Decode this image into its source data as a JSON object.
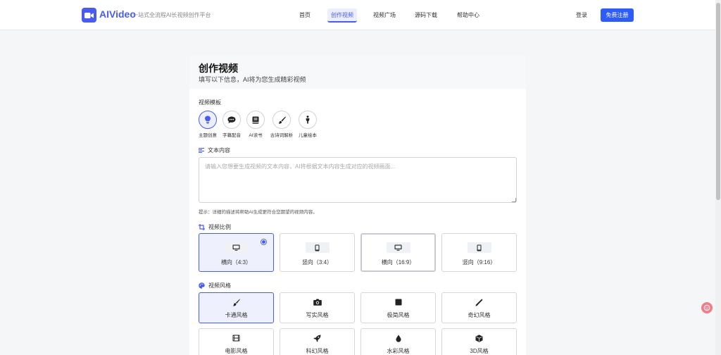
{
  "header": {
    "logo_text": "AIVideo",
    "slogan": "一站式全流程AI长视频创作平台",
    "nav": [
      {
        "label": "首页",
        "active": false
      },
      {
        "label": "创作视频",
        "active": true
      },
      {
        "label": "视频广场",
        "active": false
      },
      {
        "label": "源码下载",
        "active": false
      },
      {
        "label": "帮助中心",
        "active": false
      }
    ],
    "login_label": "登录",
    "register_label": "免费注册",
    "brand_color": "#4a5cf0"
  },
  "card": {
    "title": "创作视频",
    "subtitle": "填写以下信息，AI将为您生成精彩视频"
  },
  "template": {
    "label": "视频模板",
    "items": [
      {
        "label": "主题创意",
        "icon": "lightbulb-icon",
        "selected": true
      },
      {
        "label": "字幕配音",
        "icon": "speech-bubble-icon",
        "selected": false
      },
      {
        "label": "AI读书",
        "icon": "book-icon",
        "selected": false
      },
      {
        "label": "古诗词解析",
        "icon": "brush-icon",
        "selected": false
      },
      {
        "label": "儿童绘本",
        "icon": "child-icon",
        "selected": false
      }
    ]
  },
  "text_content": {
    "label": "文本内容",
    "value": "",
    "placeholder": "请输入您想要生成视频的文本内容，AI将根据文本内容生成对应的视频画面...",
    "hint": "提示：详细的描述将帮助AI生成更符合您期望的视频内容。"
  },
  "ratio": {
    "label": "视频比例",
    "options": [
      {
        "label": "横向（4:3）",
        "icon": "monitor-icon",
        "selected": true
      },
      {
        "label": "竖向（3:4）",
        "icon": "phone-icon",
        "selected": false
      },
      {
        "label": "横向（16:9）",
        "icon": "monitor-icon",
        "selected": false
      },
      {
        "label": "竖向（9:16）",
        "icon": "phone-icon",
        "selected": false
      }
    ]
  },
  "style": {
    "label": "视频风格",
    "options": [
      {
        "label": "卡通风格",
        "icon": "paintbrush-icon",
        "selected": true
      },
      {
        "label": "写实风格",
        "icon": "camera-icon",
        "selected": false
      },
      {
        "label": "极简风格",
        "icon": "square-icon",
        "selected": false
      },
      {
        "label": "奇幻风格",
        "icon": "wand-icon",
        "selected": false
      },
      {
        "label": "电影风格",
        "icon": "film-icon",
        "selected": false
      },
      {
        "label": "科幻风格",
        "icon": "rocket-icon",
        "selected": false
      },
      {
        "label": "水彩风格",
        "icon": "droplet-icon",
        "selected": false
      },
      {
        "label": "3D风格",
        "icon": "cube-icon",
        "selected": false
      }
    ]
  }
}
